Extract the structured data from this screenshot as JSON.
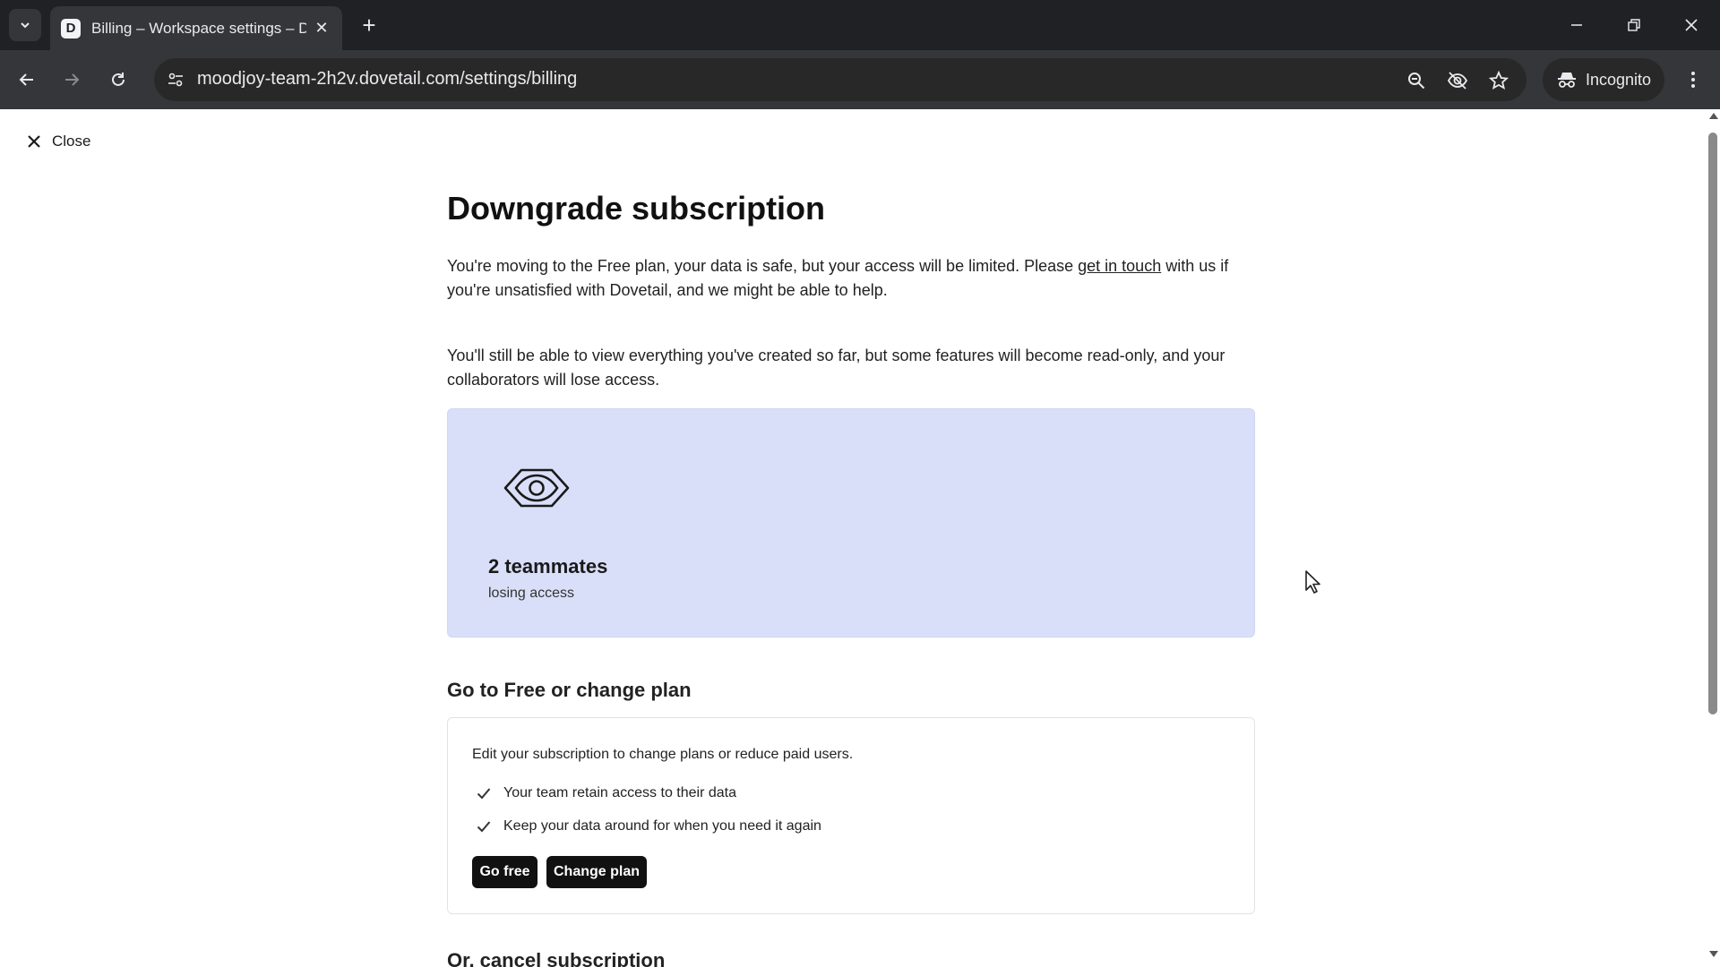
{
  "browser": {
    "tab_title": "Billing – Workspace settings – D",
    "favicon_letter": "D",
    "url": "moodjoy-team-2h2v.dovetail.com/settings/billing",
    "incognito_label": "Incognito"
  },
  "page": {
    "close_label": "Close",
    "title": "Downgrade subscription",
    "intro_before_link": "You're moving to the Free plan, your data is safe, but your access will be limited. Please ",
    "intro_link": "get in touch",
    "intro_after_link": " with us if you're unsatisfied with Dovetail, and we might be able to help.",
    "readonly_note": "You'll still be able to view everything you've created so far, but some features will become read-only, and your collaborators will lose access.",
    "impact_card": {
      "icon": "eye-icon",
      "count": "2 teammates",
      "subtitle": "losing access",
      "background": "#dadff9"
    },
    "change_plan_section": {
      "title": "Go to Free or change plan",
      "description": "Edit your subscription to change plans or reduce paid users.",
      "benefits": [
        "Your team retain access to their data",
        "Keep your data around for when you need it again"
      ],
      "go_free_label": "Go free",
      "change_plan_label": "Change plan"
    },
    "cancel_section_title": "Or, cancel subscription"
  }
}
